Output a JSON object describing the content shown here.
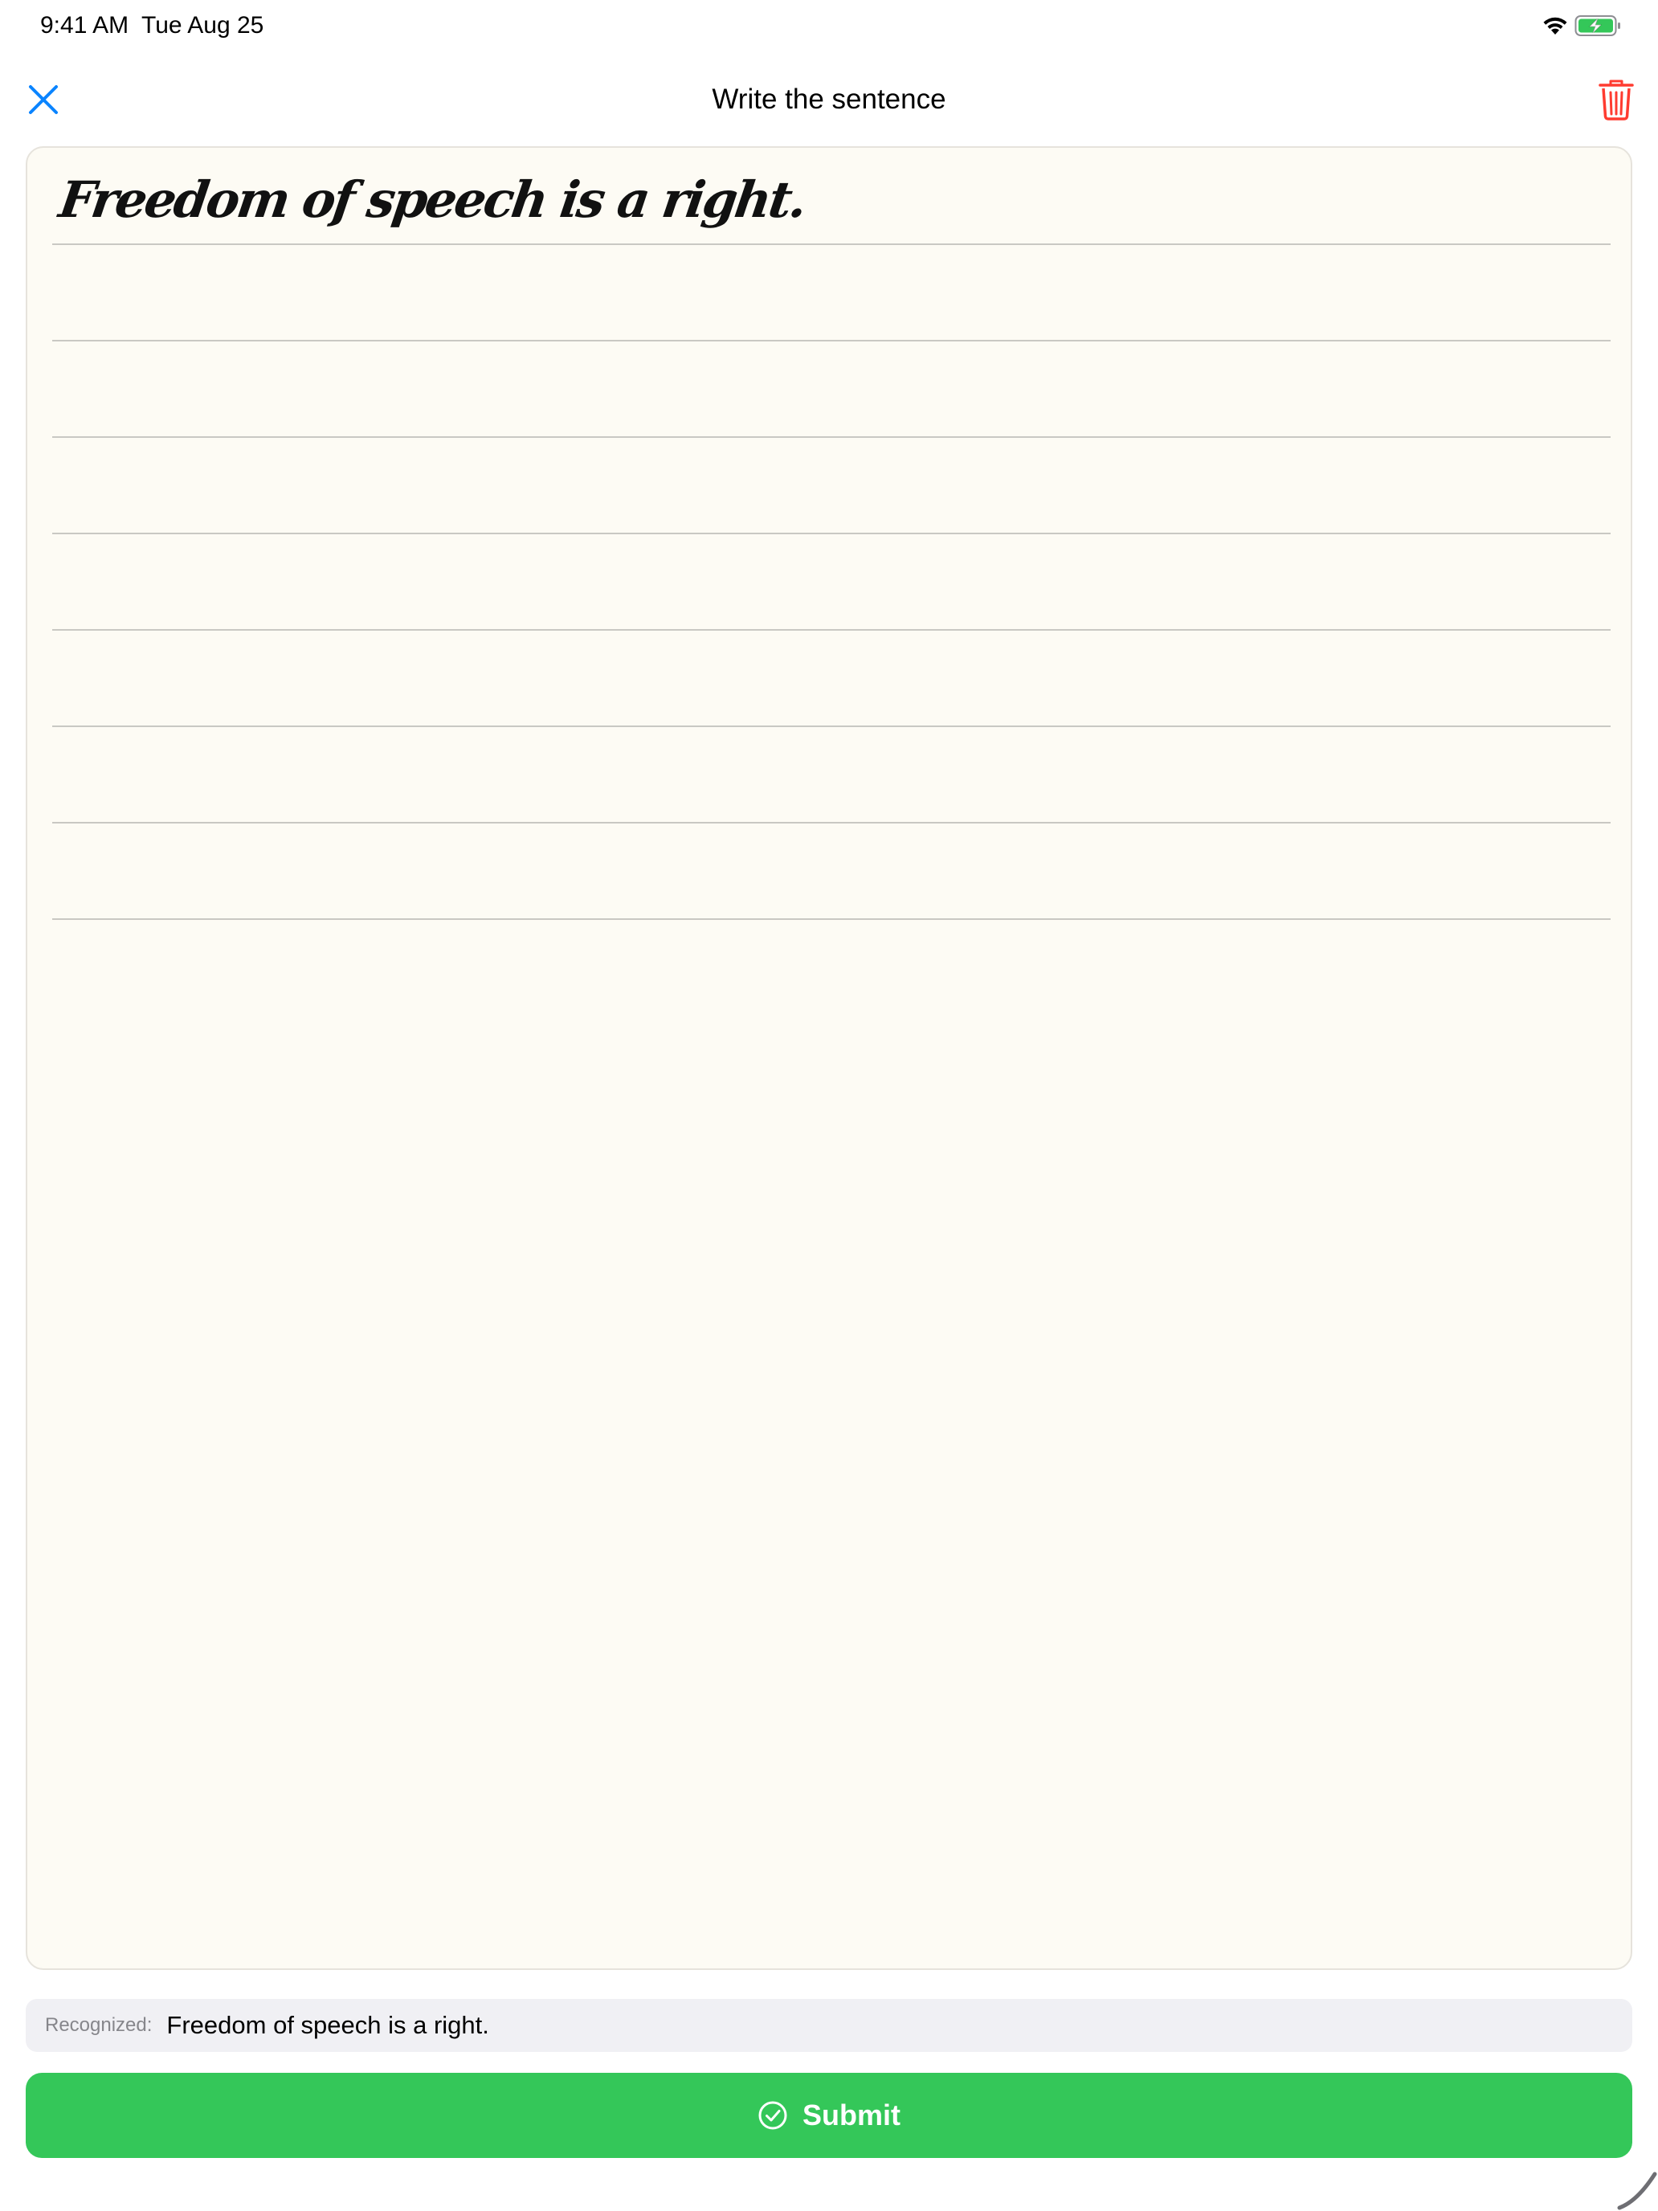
{
  "status_bar": {
    "time": "9:41 AM",
    "date": "Tue Aug 25",
    "wifi_icon": "wifi-icon",
    "battery_icon": "battery-charging-icon",
    "battery_color": "#34c759"
  },
  "nav": {
    "title": "Write the sentence",
    "close_icon": "close-icon",
    "close_color": "#0a84ff",
    "delete_icon": "trash-icon",
    "delete_color": "#ff3b30"
  },
  "canvas": {
    "model_sentence": "Freedom of speech is a right.",
    "background": "#fdfbf4",
    "line_count": 8
  },
  "recognized": {
    "label": "Recognized:",
    "text": "Freedom of speech is a right."
  },
  "submit": {
    "label": "Submit",
    "icon": "checkmark-circle-icon",
    "color": "#34c759"
  },
  "corner_icon": "pencil-stroke-icon"
}
